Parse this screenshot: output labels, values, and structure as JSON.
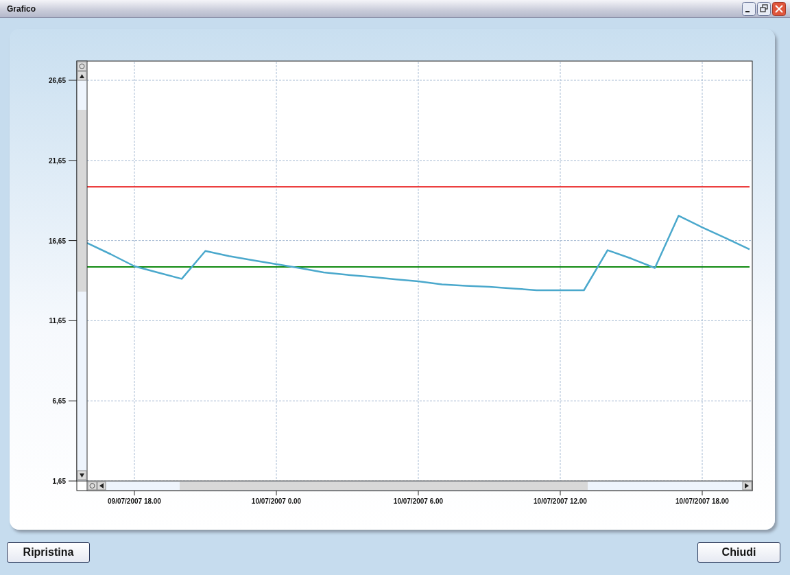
{
  "window": {
    "title": "Grafico"
  },
  "chart_data": {
    "type": "line",
    "categories": [
      null,
      null,
      "09/07/2007 18.00",
      null,
      null,
      null,
      null,
      null,
      "10/07/2007 0.00",
      null,
      null,
      null,
      null,
      null,
      "10/07/2007 6.00",
      null,
      null,
      null,
      null,
      null,
      "10/07/2007 12.00",
      null,
      null,
      null,
      null,
      null,
      "10/07/2007 18.00",
      null,
      null
    ],
    "series": [
      {
        "color": "#e81818",
        "values": [
          20,
          20,
          20,
          20,
          20,
          20,
          20,
          20,
          20,
          20,
          20,
          20,
          20,
          20,
          20,
          20,
          20,
          20,
          20,
          20,
          20,
          20,
          20,
          20,
          20,
          20,
          20,
          20,
          20
        ]
      },
      {
        "color": "#108a10",
        "values": [
          15,
          15,
          15,
          15,
          15,
          15,
          15,
          15,
          15,
          15,
          15,
          15,
          15,
          15,
          15,
          15,
          15,
          15,
          15,
          15,
          15,
          15,
          15,
          15,
          15,
          15,
          15,
          15,
          15
        ]
      },
      {
        "color": "#4aa8cc",
        "values": [
          16.5,
          15.8,
          15.05,
          14.65,
          14.26,
          16.0,
          15.68,
          15.42,
          15.18,
          14.93,
          14.67,
          14.51,
          14.38,
          14.24,
          14.11,
          13.92,
          13.83,
          13.76,
          13.66,
          13.55,
          13.55,
          13.55,
          16.05,
          15.53,
          14.94,
          18.2,
          17.47,
          16.8,
          16.1
        ]
      }
    ],
    "ylim": [
      1.65,
      26.65
    ],
    "grid": true,
    "yticks": [
      {
        "value": 1.65,
        "label": "1,65"
      },
      {
        "value": 6.65,
        "label": "6,65"
      },
      {
        "value": 11.65,
        "label": "11,65"
      },
      {
        "value": 16.65,
        "label": "16,65"
      },
      {
        "value": 21.65,
        "label": "21,65"
      },
      {
        "value": 26.65,
        "label": "26,65"
      }
    ]
  },
  "buttons": [
    {
      "label": "Ripristina"
    },
    {
      "label": "Chiudi"
    }
  ]
}
